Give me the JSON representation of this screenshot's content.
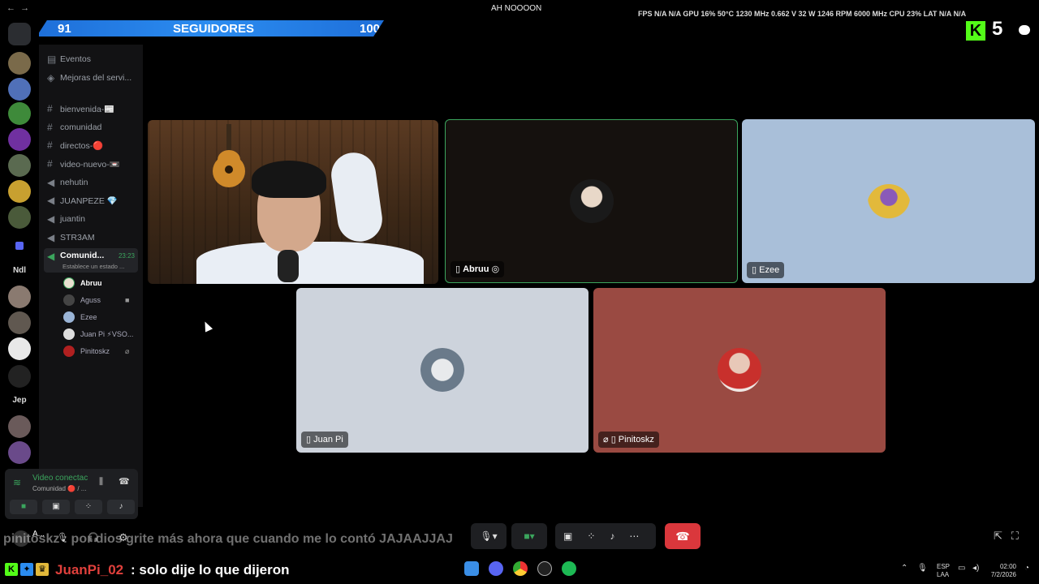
{
  "titlebar": {
    "title": "AH NOOOON",
    "back": "←",
    "forward": "→",
    "stats": "FPS N/A N/A   GPU 16% 50°C 1230 MHz 0.662 V 32 W 1246 RPM 6000 MHz   CPU 23%   LAT N/A N/A"
  },
  "stream_overlay": {
    "followers_current": "91",
    "followers_label": "SEGUIDORES",
    "followers_goal": "100",
    "kick_logo": "K",
    "viewer_count": "5"
  },
  "server_rail": {
    "text_servers": [
      "Ndl",
      "Jep"
    ]
  },
  "sidebar": {
    "items": [
      {
        "icon": "calendar-icon",
        "label": "Eventos"
      },
      {
        "icon": "boost-icon",
        "label": "Mejoras del servi..."
      },
      {
        "icon": "hash-icon",
        "label": "bienvenida-📰"
      },
      {
        "icon": "hash-icon",
        "label": "comunidad"
      },
      {
        "icon": "hash-icon",
        "label": "directos-🔴"
      },
      {
        "icon": "hash-icon",
        "label": "video-nuevo-📼"
      },
      {
        "icon": "speaker-icon",
        "label": "nehutin"
      },
      {
        "icon": "speaker-icon",
        "label": "JUANPEZE 💎"
      },
      {
        "icon": "speaker-icon",
        "label": "juantin"
      },
      {
        "icon": "speaker-icon",
        "label": "STR3AM"
      }
    ],
    "active_channel": {
      "label": "Comunid...",
      "time": "23:23",
      "status": "Establece un estado ..."
    },
    "voice_users": [
      {
        "name": "Abruu",
        "color": "#e8e0d0"
      },
      {
        "name": "Aguss",
        "color": "#444"
      },
      {
        "name": "Ezee",
        "color": "#9ab4d6"
      },
      {
        "name": "Juan Pi ⚡VSO...",
        "color": "#ddd"
      },
      {
        "name": "Pinitoskz",
        "color": "#b02020"
      }
    ]
  },
  "voice_panel": {
    "status": "Video conectac",
    "location": "Comunidad 🔴 / ..."
  },
  "user_panel": {
    "name": "A..."
  },
  "tiles": [
    {
      "name": "Abruu",
      "bg": "#15110e",
      "avatar": "#1a1a1a"
    },
    {
      "name": "Ezee",
      "bg": "#a9bfd9",
      "avatar": "#e2b93b"
    },
    {
      "name": "Juan Pi",
      "bg": "#cdd3dc",
      "avatar": "#7a8a9a"
    },
    {
      "name": "Pinitoskz",
      "bg": "#9a4a42",
      "avatar": "#c8302c"
    }
  ],
  "colors": {
    "speaking_border": "#3ba55d",
    "hangup": "#da373c",
    "accent_green": "#3ba55d"
  },
  "overlay_chat": {
    "faded": "pinitoskz : por dios grite más ahora que cuando me lo contó JAJAAJJAJ",
    "user": "JuanPi_02",
    "message": ": solo dije lo que dijeron"
  },
  "taskbar": {
    "lang_top": "ESP",
    "lang_bottom": "LAA",
    "time": "02:00",
    "date": "7/2/2026"
  }
}
